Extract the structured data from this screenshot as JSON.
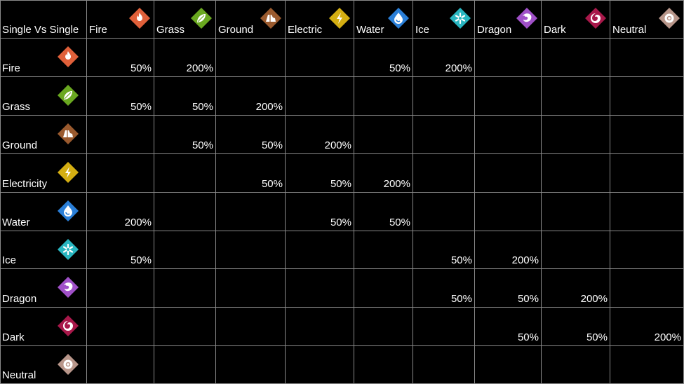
{
  "chart_data": {
    "type": "table",
    "title": "Single Vs Single",
    "corner_label": "Single Vs Single",
    "columns": [
      {
        "label": "Fire",
        "icon": "fire-icon",
        "color": "#e0603a"
      },
      {
        "label": "Grass",
        "icon": "grass-icon",
        "color": "#6aa820"
      },
      {
        "label": "Ground",
        "icon": "ground-icon",
        "color": "#9a5a2e"
      },
      {
        "label": "Electric",
        "icon": "electric-icon",
        "color": "#d4ae12"
      },
      {
        "label": "Water",
        "icon": "water-icon",
        "color": "#2a7fd8"
      },
      {
        "label": "Ice",
        "icon": "ice-icon",
        "color": "#28b5c0"
      },
      {
        "label": "Dragon",
        "icon": "dragon-icon",
        "color": "#a050c8"
      },
      {
        "label": "Dark",
        "icon": "dark-icon",
        "color": "#a8184a"
      },
      {
        "label": "Neutral",
        "icon": "neutral-icon",
        "color": "#b8968a"
      }
    ],
    "rows": [
      {
        "label": "Fire",
        "icon": "fire-icon",
        "color": "#e0603a",
        "values": [
          "50%",
          "200%",
          "",
          "",
          "50%",
          "200%",
          "",
          "",
          ""
        ]
      },
      {
        "label": "Grass",
        "icon": "grass-icon",
        "color": "#6aa820",
        "values": [
          "50%",
          "50%",
          "200%",
          "",
          "",
          "",
          "",
          "",
          ""
        ]
      },
      {
        "label": "Ground",
        "icon": "ground-icon",
        "color": "#9a5a2e",
        "values": [
          "",
          "50%",
          "50%",
          "200%",
          "",
          "",
          "",
          "",
          ""
        ]
      },
      {
        "label": "Electricity",
        "icon": "electric-icon",
        "color": "#d4ae12",
        "values": [
          "",
          "",
          "50%",
          "50%",
          "200%",
          "",
          "",
          "",
          ""
        ]
      },
      {
        "label": "Water",
        "icon": "water-icon",
        "color": "#2a7fd8",
        "values": [
          "200%",
          "",
          "",
          "50%",
          "50%",
          "",
          "",
          "",
          ""
        ]
      },
      {
        "label": "Ice",
        "icon": "ice-icon",
        "color": "#28b5c0",
        "values": [
          "50%",
          "",
          "",
          "",
          "",
          "50%",
          "200%",
          "",
          ""
        ]
      },
      {
        "label": "Dragon",
        "icon": "dragon-icon",
        "color": "#a050c8",
        "values": [
          "",
          "",
          "",
          "",
          "",
          "50%",
          "50%",
          "200%",
          ""
        ]
      },
      {
        "label": "Dark",
        "icon": "dark-icon",
        "color": "#a8184a",
        "values": [
          "",
          "",
          "",
          "",
          "",
          "",
          "50%",
          "50%",
          "200%"
        ]
      },
      {
        "label": "Neutral",
        "icon": "neutral-icon",
        "color": "#b8968a",
        "values": [
          "",
          "",
          "",
          "",
          "",
          "",
          "",
          "",
          ""
        ]
      }
    ]
  }
}
